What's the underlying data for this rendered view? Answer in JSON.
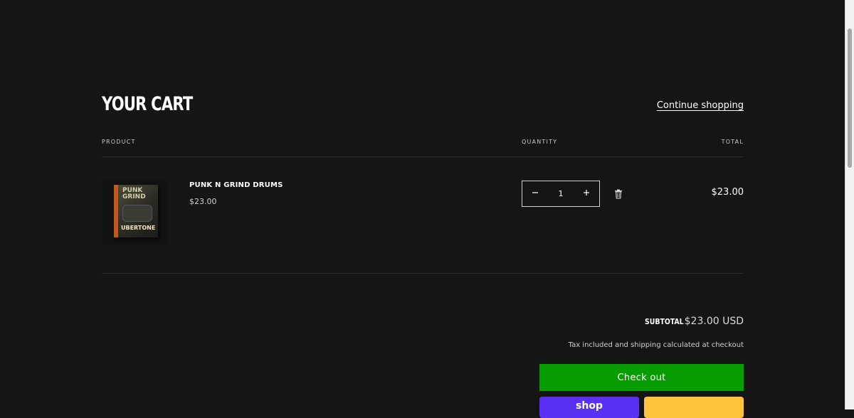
{
  "cart": {
    "title": "YOUR CART",
    "continue_label": "Continue shopping",
    "columns": {
      "product": "PRODUCT",
      "quantity": "QUANTITY",
      "total": "TOTAL"
    },
    "items": [
      {
        "name": "PUNK N GRIND DRUMS",
        "price": "$23.00",
        "quantity": "1",
        "total": "$23.00",
        "image_text_top": "PUNK GRIND",
        "image_text_bottom": "UBERTONE"
      }
    ]
  },
  "summary": {
    "subtotal_label": "SUBTOTAL",
    "subtotal_value": "$23.00 USD",
    "tax_note": "Tax included and shipping calculated at checkout",
    "checkout_label": "Check out",
    "shop_pay_label": "shop"
  },
  "colors": {
    "background": "#151515",
    "checkout": "#079c00",
    "shop_pay": "#5a31f4",
    "paypal": "#ffc439"
  },
  "icons": {
    "minus": "minus-icon",
    "plus": "plus-icon",
    "trash": "trash-icon"
  }
}
